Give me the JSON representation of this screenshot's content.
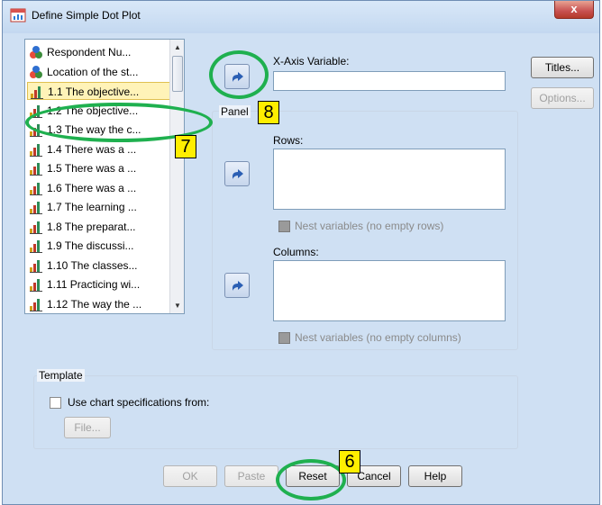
{
  "window": {
    "title": "Define Simple Dot Plot",
    "close_label": "x"
  },
  "variables": {
    "items": [
      {
        "label": "Respondent Nu...",
        "icon": "nominal-icon"
      },
      {
        "label": "Location of the st...",
        "icon": "nominal-icon"
      },
      {
        "label": "1.1 The objective...",
        "icon": "scale-icon",
        "selected": true
      },
      {
        "label": "1.2 The objective...",
        "icon": "scale-icon"
      },
      {
        "label": "1.3 The way the c...",
        "icon": "scale-icon"
      },
      {
        "label": "1.4 There was a ...",
        "icon": "scale-icon"
      },
      {
        "label": "1.5 There was a ...",
        "icon": "scale-icon"
      },
      {
        "label": "1.6 There was a ...",
        "icon": "scale-icon"
      },
      {
        "label": "1.7 The learning ...",
        "icon": "scale-icon"
      },
      {
        "label": "1.8 The preparat...",
        "icon": "scale-icon"
      },
      {
        "label": "1.9 The discussi...",
        "icon": "scale-icon"
      },
      {
        "label": "1.10 The classes...",
        "icon": "scale-icon"
      },
      {
        "label": "1.11 Practicing wi...",
        "icon": "scale-icon"
      },
      {
        "label": "1.12 The way the ...",
        "icon": "scale-icon"
      }
    ]
  },
  "xaxis": {
    "label": "X-Axis Variable:",
    "value": ""
  },
  "panel": {
    "title": "Panel",
    "rows_label": "Rows:",
    "nest_rows_label": "Nest variables (no empty rows)",
    "columns_label": "Columns:",
    "nest_columns_label": "Nest variables (no empty columns)"
  },
  "side_buttons": {
    "titles": "Titles...",
    "options": "Options..."
  },
  "template": {
    "title": "Template",
    "use_chart_label": "Use chart specifications from:",
    "file_button": "File..."
  },
  "buttons": {
    "ok": "OK",
    "paste": "Paste",
    "reset": "Reset",
    "cancel": "Cancel",
    "help": "Help"
  },
  "annotations": {
    "marker_6": "6",
    "marker_7": "7",
    "marker_8": "8",
    "ring_color": "#1fb04f",
    "marker_color": "#ffee00"
  }
}
